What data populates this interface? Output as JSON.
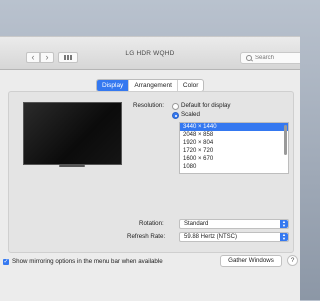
{
  "window": {
    "title": "LG HDR WQHD",
    "back_label": "‹",
    "forward_label": "›",
    "search_placeholder": "Search"
  },
  "tabs": [
    {
      "label": "Display",
      "active": true
    },
    {
      "label": "Arrangement",
      "active": false
    },
    {
      "label": "Color",
      "active": false
    }
  ],
  "display": {
    "resolution_label": "Resolution:",
    "option_default": "Default for display",
    "option_scaled": "Scaled",
    "selected_option": "Scaled",
    "resolutions": [
      "3440 × 1440",
      "2048 × 858",
      "1920 × 804",
      "1720 × 720",
      "1600 × 670",
      "1080"
    ],
    "selected_resolution": "3440 × 1440",
    "rotation_label": "Rotation:",
    "rotation_value": "Standard",
    "refresh_label": "Refresh Rate:",
    "refresh_value": "59.88 Hertz (NTSC)"
  },
  "footer": {
    "mirror_label": "Show mirroring options in the menu bar when available",
    "mirror_checked": true,
    "gather_label": "Gather Windows",
    "help_label": "?"
  },
  "colors": {
    "accent": "#3478f0"
  }
}
